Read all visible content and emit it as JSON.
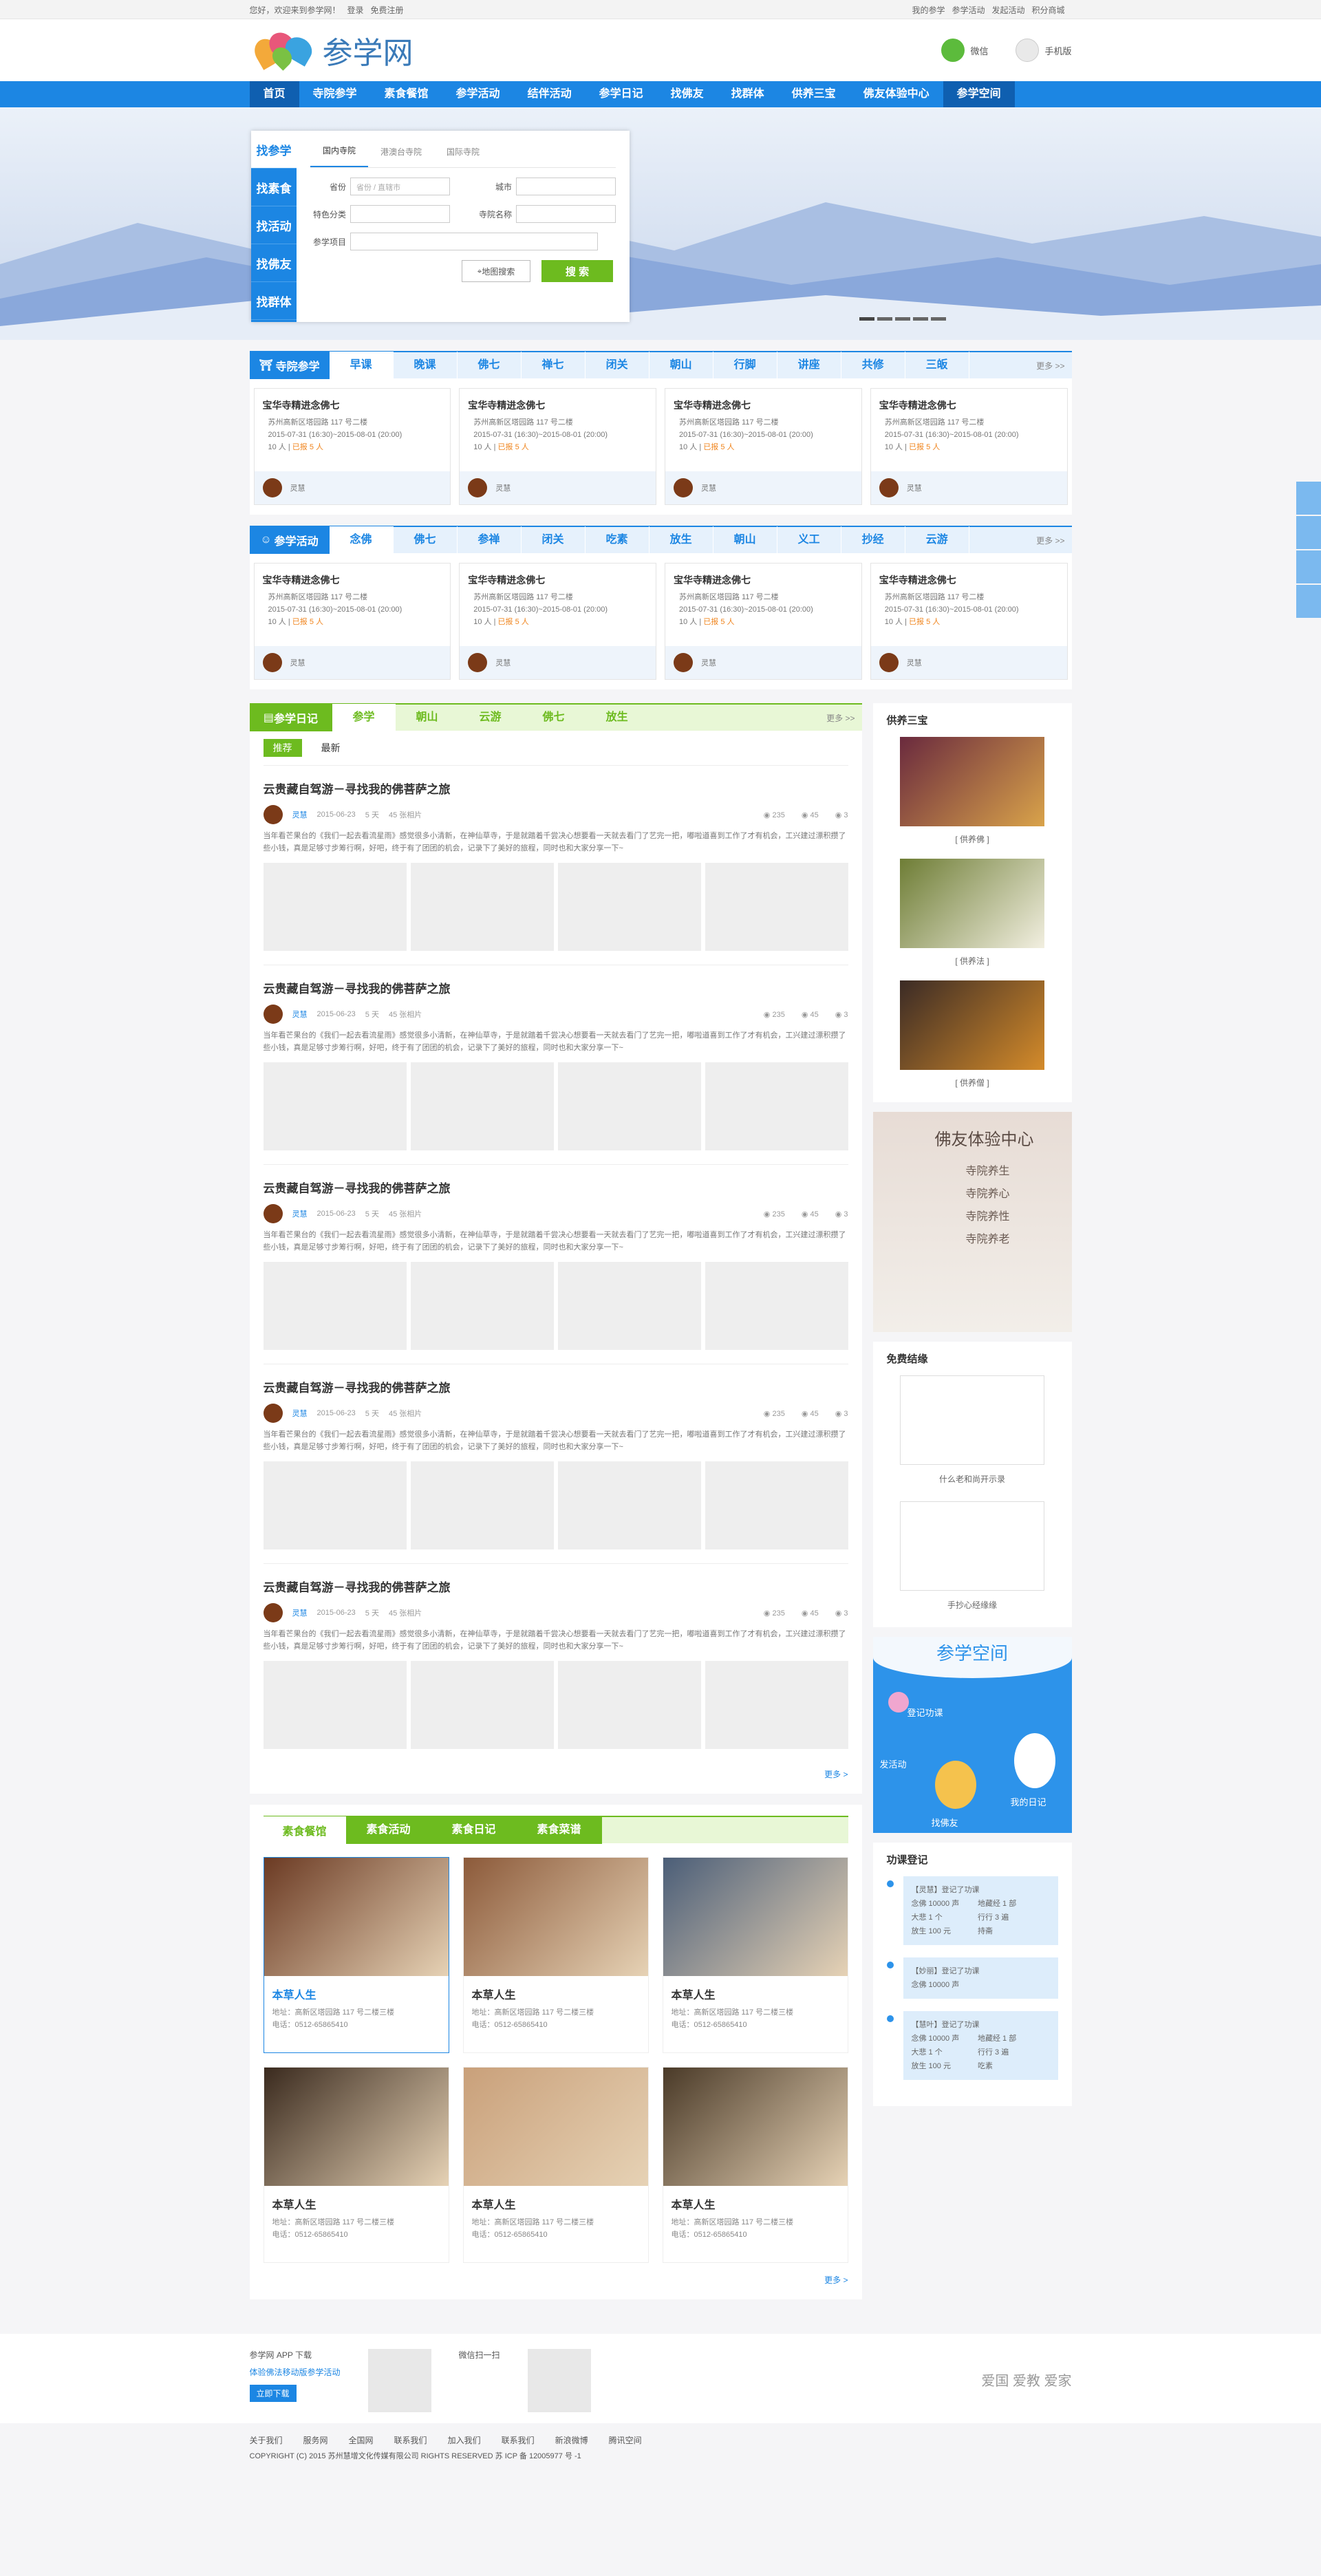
{
  "topbar": {
    "welcome": "您好，欢迎来到参学网！",
    "login": "登录",
    "register": "免费注册",
    "links": [
      "我的参学",
      "参学活动",
      "发起活动",
      "积分商城"
    ]
  },
  "header": {
    "logo_text": "参学网",
    "wechat": "微信",
    "mobile": "手机版"
  },
  "nav": [
    "首页",
    "寺院参学",
    "素食餐馆",
    "参学活动",
    "结伴活动",
    "参学日记",
    "找佛友",
    "找群体",
    "供养三宝",
    "佛友体验中心",
    "参学空间"
  ],
  "search": {
    "side": [
      "找参学",
      "找素食",
      "找活动",
      "找佛友",
      "找群体"
    ],
    "tabs": [
      "国内寺院",
      "港澳台寺院",
      "国际寺院"
    ],
    "province_label": "省份",
    "province_ph": "省份 / 直辖市",
    "city_label": "城市",
    "cat_label": "特色分类",
    "temple_label": "寺院名称",
    "item_label": "参学项目",
    "map_btn": "地图搜索",
    "go_btn": "搜 索"
  },
  "temple": {
    "label": "寺院参学",
    "tabs": [
      "早课",
      "晚课",
      "佛七",
      "禅七",
      "闭关",
      "朝山",
      "行脚",
      "讲座",
      "共修",
      "三皈"
    ],
    "more": "更多 >>"
  },
  "activity": {
    "label": "参学活动",
    "tabs": [
      "念佛",
      "佛七",
      "参禅",
      "闭关",
      "吃素",
      "放生",
      "朝山",
      "义工",
      "抄经",
      "云游"
    ],
    "more": "更多 >>"
  },
  "card": {
    "title": "宝华寺精进念佛七",
    "addr": "苏州高新区塔园路 117 号二楼",
    "time": "2015-07-31 (16:30)~2015-08-01 (20:00)",
    "people": "10 人",
    "joined": "已报 5 人",
    "user": "灵慧"
  },
  "diary": {
    "label": "参学日记",
    "tabs": [
      "参学",
      "朝山",
      "云游",
      "佛七",
      "放生"
    ],
    "more": "更多 >>",
    "sub": [
      "推荐",
      "最新"
    ],
    "post": {
      "title": "云贵藏自驾游－寻找我的佛菩萨之旅",
      "user": "灵慧",
      "date": "2015-06-23",
      "days": "5 天",
      "pics": "45 张相片",
      "s1": "235",
      "s2": "45",
      "s3": "3",
      "text": "当年看芒果台的《我们一起去看流星雨》感觉很多小清新，在神仙草寺，于是就踏着千尝决心想要看一天就去看门了艺完一把，嘟啦道喜到工作了才有机会，工兴建过漂积攒了些小钱，真是足够寸步筹行啊，好吧，终于有了团团的机会，记录下了美好的旅程，同时也和大家分享一下~"
    },
    "bottom_more": "更多 >"
  },
  "gifts": {
    "title": "供养三宝",
    "items": [
      "[ 供养佛 ]",
      "[ 供养法 ]",
      "[ 供养僧 ]"
    ]
  },
  "exp": {
    "title": "佛友体验中心",
    "items": [
      "寺院养生",
      "寺院养心",
      "寺院养性",
      "寺院养老"
    ]
  },
  "free": {
    "title": "免费结缘",
    "items": [
      "什么老和尚开示录",
      "手抄心经缘缘"
    ]
  },
  "space": {
    "title": "参学空间",
    "items": [
      "登记功课",
      "发活动",
      "我的日记",
      "找佛友"
    ]
  },
  "merits": {
    "title": "功课登记",
    "entries": [
      {
        "head": "【灵慧】登记了功课",
        "lines": [
          "念佛 10000 声",
          "地藏经 1 部",
          "大悲 1 个",
          "行行 3 遍",
          "放生 100 元",
          "持斋"
        ]
      },
      {
        "head": "【妙丽】登记了功课",
        "lines": [
          "念佛 10000 声"
        ]
      },
      {
        "head": "【慧叶】登记了功课",
        "lines": [
          "念佛 10000 声",
          "地藏经 1 部",
          "大悲 1 个",
          "行行 3 遍",
          "放生 100 元",
          "吃素"
        ]
      }
    ]
  },
  "food": {
    "tabs": [
      "素食餐馆",
      "素食活动",
      "素食日记",
      "素食菜谱"
    ],
    "name": "本草人生",
    "addr": "地址：高新区塔园路 117 号二楼三楼",
    "tel": "电话：0512-65865410",
    "more": "更多 >"
  },
  "footer": {
    "app": "参学网 APP 下载",
    "app_sub": "体验佛法移动版参学活动",
    "dl_btn": "立即下载",
    "weixin": "微信扫一扫",
    "slogan": "爱国  爱教  爱家",
    "links": [
      "关于我们",
      "服务网",
      "全国网",
      "联系我们",
      "加入我们",
      "联系我们",
      "新浪微博",
      "腾讯空间"
    ],
    "copy": "COPYRIGHT (C) 2015 苏州慧增文化传媒有限公司 RIGHTS RESERVED 苏 ICP 备 12005977 号 -1"
  }
}
